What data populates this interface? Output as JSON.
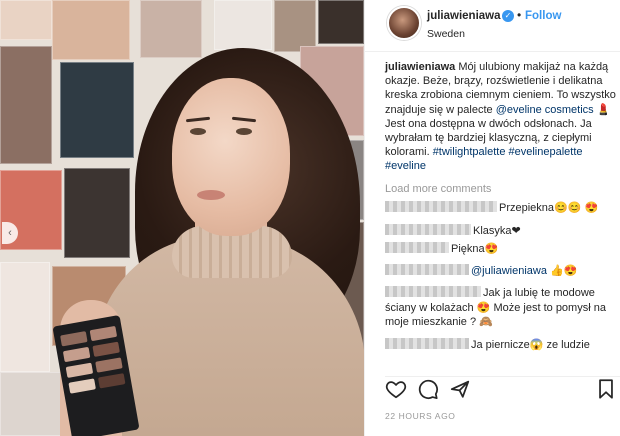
{
  "post": {
    "username": "juliawieniawa",
    "follow_label": "Follow",
    "location": "Sweden",
    "dot": "•",
    "caption_text_1": "Mój ulubiony makijaż na każdą okazje. Beże, brązy, rozświetlenie i delikatna kreska zrobiona ciemnym cieniem. To wszystko znajduje się w palecte ",
    "caption_mention": "@eveline cosmetics",
    "caption_text_2": " 💄 Jest ona dostępna w dwóch odsłonach. Ja wybrałam tę bardziej klasyczną, z ciepłymi kolorami. ",
    "caption_tags": "#twilightpalette #evelinepalette #eveline",
    "load_more": "Load more comments",
    "timestamp": "22 HOURS AGO"
  },
  "comments": [
    {
      "text": "Przepiekna😊😊 😍"
    },
    {
      "text": "Klasyka❤"
    },
    {
      "text": "Piękna😍"
    },
    {
      "text": "@juliawieniawa 👍😍"
    },
    {
      "text": "Jak ja lubię te modowe ściany w kolażach 😍 Może jest to pomysł na moje mieszkanie ? 🙈"
    },
    {
      "text": "Ja piernicze😱 ze ludzie"
    }
  ],
  "icons": {
    "like": "heart-icon",
    "comment": "comment-icon",
    "share": "share-icon",
    "save": "bookmark-icon",
    "verified": "verified-badge-icon",
    "carousel": "chevron-left-icon"
  },
  "colors": {
    "link": "#003569",
    "follow": "#3897f0",
    "muted": "#999999"
  }
}
